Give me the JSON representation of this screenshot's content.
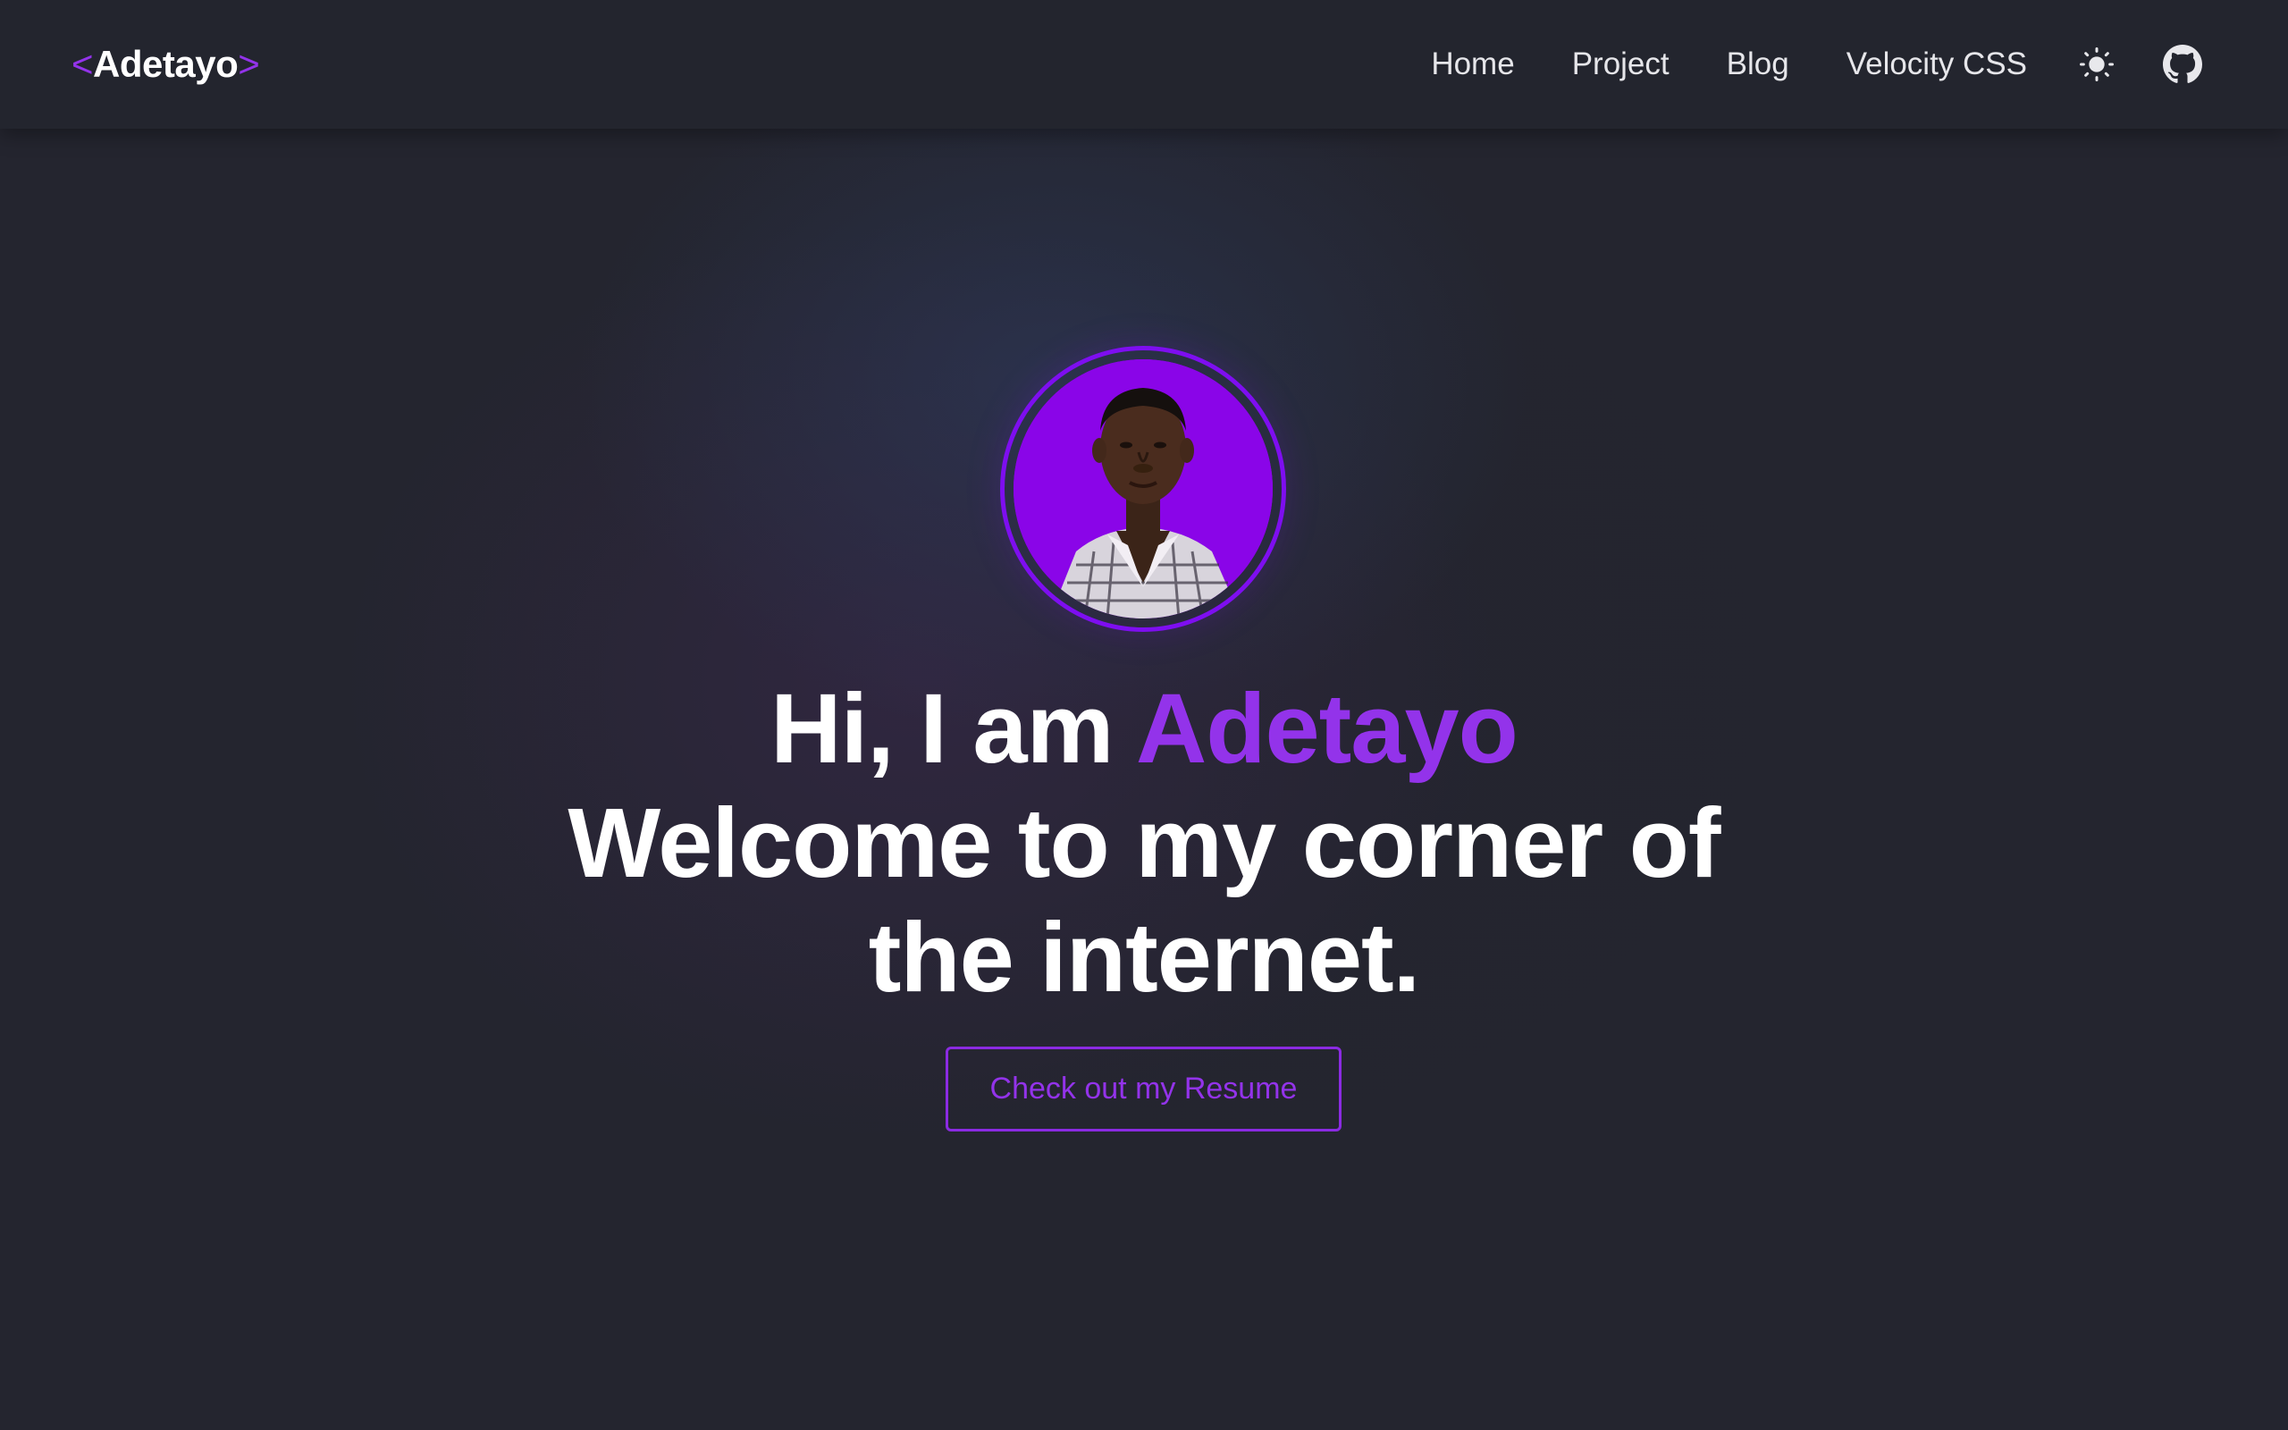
{
  "brand": {
    "open_bracket": "<",
    "name": "Adetayo",
    "close_bracket": ">"
  },
  "nav": {
    "links": [
      {
        "label": "Home"
      },
      {
        "label": "Project"
      },
      {
        "label": "Blog"
      },
      {
        "label": "Velocity CSS"
      }
    ],
    "theme_toggle_icon": "sun-icon",
    "github_icon": "github-icon"
  },
  "hero": {
    "greeting": "Hi, I am ",
    "name": "Adetayo",
    "tagline_line1": "Welcome to my corner of",
    "tagline_line2": "the internet.",
    "cta_label": "Check out my Resume"
  },
  "colors": {
    "accent": "#9333ea",
    "background": "#24252f",
    "navbar": "#23252e",
    "avatar_bg": "#8a05e8"
  }
}
